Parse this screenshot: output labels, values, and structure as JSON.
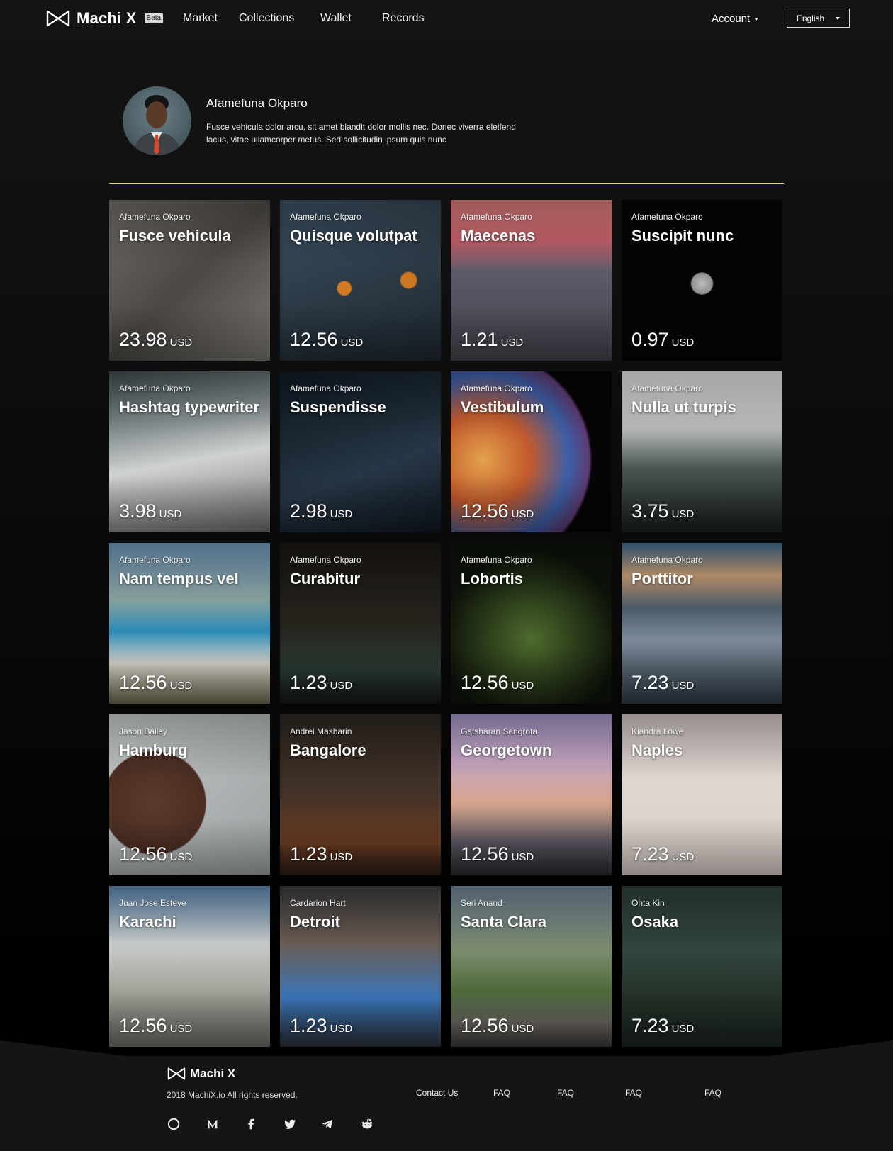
{
  "nav": {
    "brand": "Machi X",
    "beta": "Beta",
    "links": [
      "Market",
      "Collections",
      "Wallet",
      "Records"
    ],
    "account": "Account",
    "language": "English"
  },
  "profile": {
    "name": "Afamefuna Okparo",
    "bio": "Fusce vehicula dolor arcu, sit amet blandit dolor mollis nec. Donec viverra eleifend lacus, vitae ullamcorper metus. Sed sollicitudin ipsum quis nunc"
  },
  "cards": [
    {
      "author": "Afamefuna Okparo",
      "title": "Fusce vehicula",
      "price": "23.98",
      "currency": "USD",
      "bg": "linear-gradient(135deg,#6d6a66,#4b4845 50%,#7a7772)"
    },
    {
      "author": "Afamefuna Okparo",
      "title": "Quisque volutpat",
      "price": "12.56",
      "currency": "USD",
      "bg": "radial-gradient(circle at 40% 55%,#d37a23 0,#d37a23 5%,transparent 6%),radial-gradient(circle at 80% 50%,#cf7623 0,#cf7623 5%,transparent 6%),linear-gradient(160deg,#3b4f60,#2b3945 55%,#1e2730)"
    },
    {
      "author": "Afamefuna Okparo",
      "title": "Maecenas",
      "price": "1.21",
      "currency": "USD",
      "bg": "linear-gradient(180deg,#d67a7a 0,#c4606b 25%,#5a5a68 45%,#45434d 100%)"
    },
    {
      "author": "Afamefuna Okparo",
      "title": "Suscipit nunc",
      "price": "0.97",
      "currency": "USD",
      "bg": "radial-gradient(circle at 50% 52%,#bdbdbd 0,#8f8f8f 9%,transparent 10%),#050505"
    },
    {
      "author": "Afamefuna Okparo",
      "title": "Hashtag typewriter",
      "price": "3.98",
      "currency": "USD",
      "bg": "linear-gradient(170deg,#3b4a4c 0,#8d9596 35%,#cfd2d1 55%,#6a6c69 100%)"
    },
    {
      "author": "Afamefuna Okparo",
      "title": "Suspendisse",
      "price": "2.98",
      "currency": "USD",
      "bg": "linear-gradient(160deg,#0f1a24,#1d2b37 40%,#273646 60%,#0f1820)"
    },
    {
      "author": "Afamefuna Okparo",
      "title": "Vestibulum",
      "price": "12.56",
      "currency": "USD",
      "bg": "radial-gradient(circle at 20% 55%,#e3a24b 0,#c35a2d 30%,#3c5fa8 55%,#5e3b72 68%,#050505 70%)"
    },
    {
      "author": "Afamefuna Okparo",
      "title": "Nulla ut turpis",
      "price": "3.75",
      "currency": "USD",
      "bg": "linear-gradient(180deg,#dcdcdc 0,#b9bcbb 35%,#4a5550 60%,#1a211e 100%)"
    },
    {
      "author": "Afamefuna Okparo",
      "title": "Nam tempus vel",
      "price": "12.56",
      "currency": "USD",
      "bg": "linear-gradient(180deg,#6e95b8 0,#8aa3a0 35%,#2b8ab4 55%,#d7d3cb 75%,#6d6a4d 100%)"
    },
    {
      "author": "Afamefuna Okparo",
      "title": "Curabitur",
      "price": "1.23",
      "currency": "USD",
      "bg": "linear-gradient(180deg,#1a1712 0,#25231c 50%,#2a3a33 80%,#151713 100%)"
    },
    {
      "author": "Afamefuna Okparo",
      "title": "Lobortis",
      "price": "12.56",
      "currency": "USD",
      "bg": "radial-gradient(circle at 50% 60%,#4e6b2d 0,#2d3e1b 35%,#0d120a 70%)"
    },
    {
      "author": "Afamefuna Okparo",
      "title": "Porttitor",
      "price": "7.23",
      "currency": "USD",
      "bg": "linear-gradient(180deg,#3f6a92 0,#c69c74 20%,#4b5a68 40%,#7c8a98 60%,#2f3b47 100%)"
    },
    {
      "author": "Jason Bailey",
      "title": "Hamburg",
      "price": "12.56",
      "currency": "USD",
      "bg": "radial-gradient(circle at 28% 55%,#5b3a2c 0,#4a2d22 35%,transparent 36%),linear-gradient(135deg,#c3c6c7,#9ea2a3)"
    },
    {
      "author": "Andrei Masharin",
      "title": "Bangalore",
      "price": "1.23",
      "currency": "USD",
      "bg": "linear-gradient(180deg,#2d2620 0,#433328 50%,#6b3c22 80%,#2a1d15 100%)"
    },
    {
      "author": "Gatsharan Sangrota",
      "title": "Georgetown",
      "price": "12.56",
      "currency": "USD",
      "bg": "linear-gradient(180deg,#9c8fbf 0,#c7a6c2 30%,#d6a48b 55%,#5a5663 80%,#2c2a2e 100%)"
    },
    {
      "author": "Kiandra Lowe",
      "title": "Naples",
      "price": "7.23",
      "currency": "USD",
      "bg": "linear-gradient(180deg,#c8bfbb 0,#e0d6d2 40%,#d9cec8 100%)"
    },
    {
      "author": "Juan Jose Esteve",
      "title": "Karachi",
      "price": "12.56",
      "currency": "USD",
      "bg": "linear-gradient(180deg,#5b84ad 0,#c9cdcb 35%,#a3a39b 65%,#6c6c66 100%)"
    },
    {
      "author": "Cardarion Hart",
      "title": "Detroit",
      "price": "1.23",
      "currency": "USD",
      "bg": "linear-gradient(180deg,#3a3b3d 0,#6b5c53 35%,#3a76b9 70%,#2b2f39 100%)"
    },
    {
      "author": "Seri Anand",
      "title": "Santa Clara",
      "price": "12.56",
      "currency": "USD",
      "bg": "linear-gradient(180deg,#6e8194 0,#7d8c70 40%,#4d6a3b 65%,#6b6761 85%,#3a3937 100%)"
    },
    {
      "author": "Ohta Kin",
      "title": "Osaka",
      "price": "7.23",
      "currency": "USD",
      "bg": "linear-gradient(180deg,#2d3d38 0,#31463e 40%,#243128 70%,#1b2420 100%)"
    }
  ],
  "footer": {
    "brand": "Machi X",
    "copyright": "2018 MachiX.io All rights reserved.",
    "links": [
      "Contact Us",
      "FAQ",
      "FAQ",
      "FAQ",
      "FAQ"
    ],
    "social_icons": [
      "steemit-icon",
      "medium-icon",
      "facebook-icon",
      "twitter-icon",
      "telegram-icon",
      "reddit-icon"
    ]
  }
}
